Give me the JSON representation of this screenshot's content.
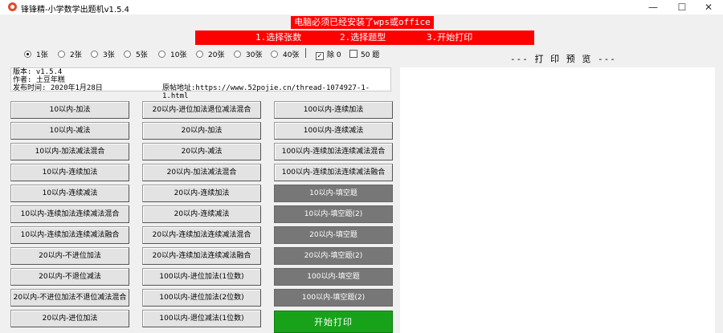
{
  "window": {
    "title": "锋锋精-小学数学出题机v1.5.4"
  },
  "banners": {
    "notice": "电脑必须已经安装了wps或office",
    "steps": [
      "1.选择张数",
      "2.选择题型",
      "3.开始打印"
    ]
  },
  "options": {
    "radios": [
      {
        "label": "1张",
        "checked": true
      },
      {
        "label": "2张",
        "checked": false
      },
      {
        "label": "3张",
        "checked": false
      },
      {
        "label": "5张",
        "checked": false
      },
      {
        "label": "10张",
        "checked": false
      },
      {
        "label": "20张",
        "checked": false
      },
      {
        "label": "30张",
        "checked": false
      },
      {
        "label": "40张",
        "checked": false
      }
    ],
    "checkboxes": [
      {
        "label": "除 0",
        "checked": true
      },
      {
        "label": "50 题",
        "checked": false
      }
    ]
  },
  "preview": {
    "title": "--- 打 印 预 览 ---"
  },
  "info": {
    "version": "版本: v1.5.4",
    "author": "作者: 土豆年糕",
    "date": "发布时间: 2020年1月28日",
    "url": "原帖地址:https://www.52pojie.cn/thread-1074927-1-1.html"
  },
  "buttons": {
    "col1": [
      "10以内-加法",
      "10以内-减法",
      "10以内-加法减法混合",
      "10以内-连续加法",
      "10以内-连续减法",
      "10以内-连续加法连续减法混合",
      "10以内-连续加法连续减法融合",
      "20以内-不进位加法",
      "20以内-不退位减法",
      "20以内-不进位加法不退位减法混合",
      "20以内-进位加法"
    ],
    "col2": [
      "20以内-进位加法退位减法混合",
      "20以内-加法",
      "20以内-减法",
      "20以内-加法减法混合",
      "20以内-连续加法",
      "20以内-连续减法",
      "20以内-连续加法连续减法混合",
      "20以内-连续加法连续减法融合",
      "100以内-进位加法(1位数)",
      "100以内-进位加法(2位数)",
      "100以内-退位减法(1位数)"
    ],
    "col3": [
      "100以内-连续加法",
      "100以内-连续减法",
      "100以内-连续加法连续减法混合",
      "100以内-连续加法连续减法融合",
      "10以内-填空题",
      "10以内-填空题(2)",
      "20以内-填空题",
      "20以内-填空题(2)",
      "100以内-填空题",
      "100以内-填空题(2)"
    ],
    "print": "开始打印"
  },
  "colors": {
    "banner": "#ff0000",
    "print": "#17a21a",
    "gray_button": "#777777"
  }
}
